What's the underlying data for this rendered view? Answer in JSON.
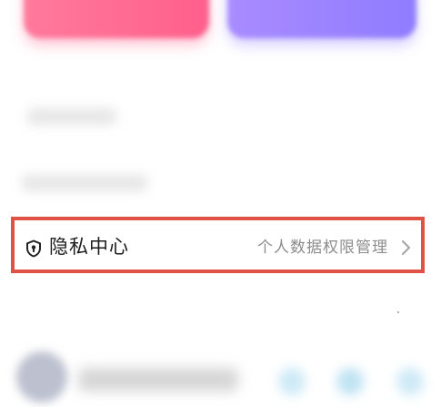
{
  "privacy_row": {
    "title": "隐私中心",
    "subtitle": "个人数据权限管理",
    "icon": "shield-lock-icon",
    "chevron": "chevron-right-icon"
  },
  "colors": {
    "highlight_border": "#e05245",
    "pink_button": "#ff5f8b",
    "purple_button": "#8f7cff",
    "title_text": "#1c1c1c",
    "subtitle_text": "#8c8c8c"
  }
}
